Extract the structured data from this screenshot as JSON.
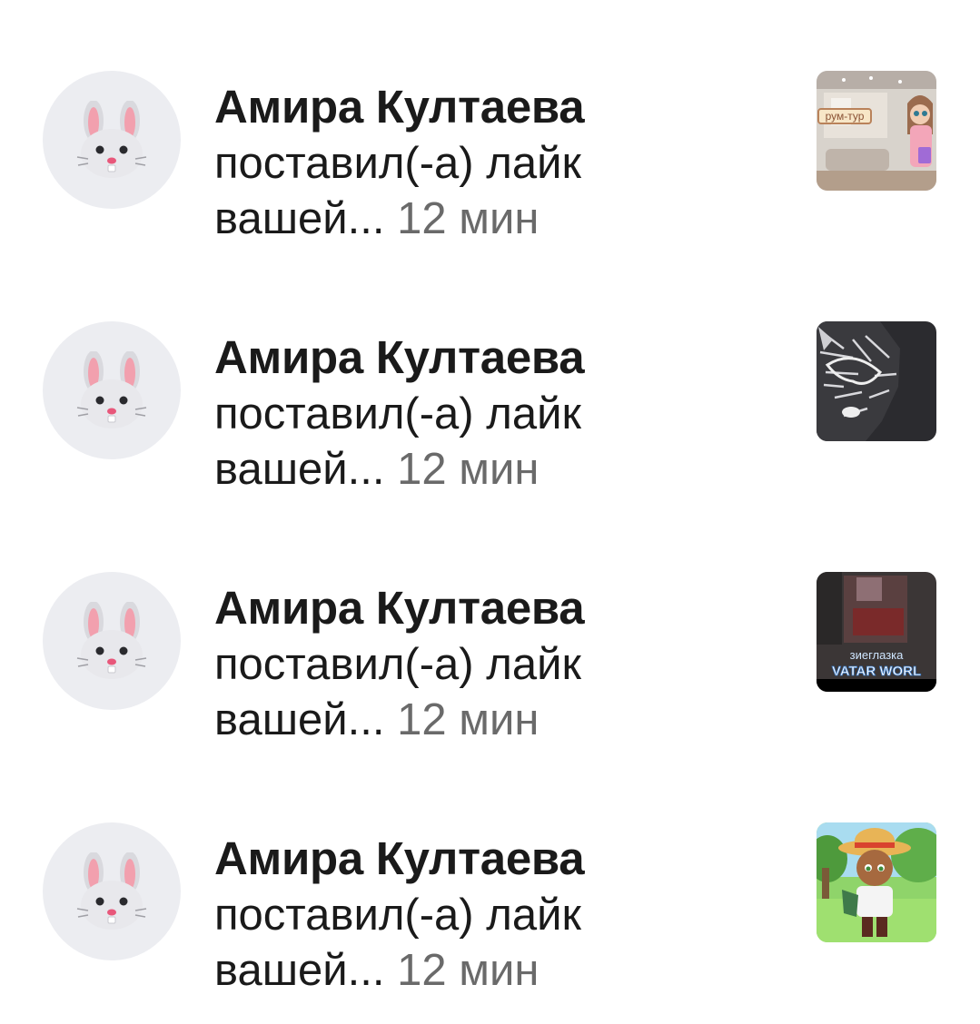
{
  "notifications": [
    {
      "user": "Амира Култаева",
      "action_line1": "поставил(-а) лайк",
      "action_line2": "вашей...",
      "time": "12 мин",
      "thumb_text": "рум-тур"
    },
    {
      "user": "Амира Култаева",
      "action_line1": "поставил(-а) лайк",
      "action_line2": "вашей...",
      "time": "12 мин"
    },
    {
      "user": "Амира Култаева",
      "action_line1": "поставил(-а) лайк",
      "action_line2": "вашей...",
      "time": "12 мин",
      "thumb_text": "зиеглазка",
      "thumb_text2": "VATAR WORL"
    },
    {
      "user": "Амира Култаева",
      "action_line1": "поставил(-а) лайк",
      "action_line2": "вашей...",
      "time": "12 мин"
    }
  ],
  "colors": {
    "avatar_bg": "#ecedf1",
    "time_text": "#6a6a6a"
  },
  "icons": {
    "avatar": "rabbit-face-icon"
  }
}
